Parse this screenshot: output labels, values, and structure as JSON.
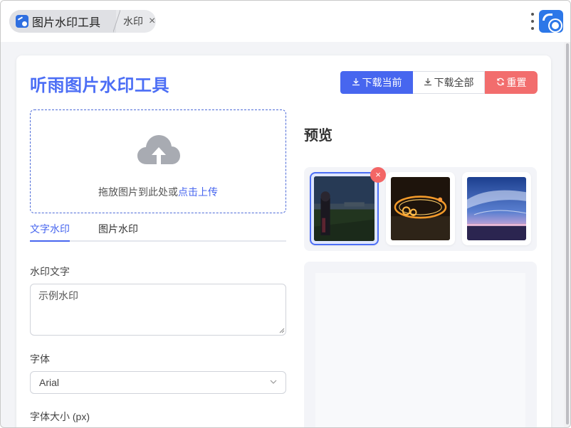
{
  "browser": {
    "tabs": [
      {
        "label": "图片水印工具",
        "icon": "app-icon"
      },
      {
        "label": "水印",
        "close": "×"
      }
    ]
  },
  "header": {
    "title": "听雨图片水印工具",
    "buttons": {
      "download_current": "下载当前",
      "download_all": "下载全部",
      "reset": "重置"
    }
  },
  "upload": {
    "text_before": "拖放图片到此处或",
    "link_text": "点击上传",
    "icon": "cloud-upload-icon"
  },
  "watermark_tabs": [
    "文字水印",
    "图片水印"
  ],
  "form": {
    "text_label": "水印文字",
    "text_value": "示例水印",
    "font_label": "字体",
    "font_value": "Arial",
    "size_label": "字体大小 (px)"
  },
  "preview": {
    "title": "预览",
    "thumbnails": [
      {
        "name": "anime-night-field",
        "selected": true
      },
      {
        "name": "fire-ring"
      },
      {
        "name": "starry-sky"
      }
    ],
    "remove_label": "×"
  },
  "colors": {
    "primary": "#4766ef",
    "danger": "#f26d6d",
    "title": "#4c6ef5"
  }
}
